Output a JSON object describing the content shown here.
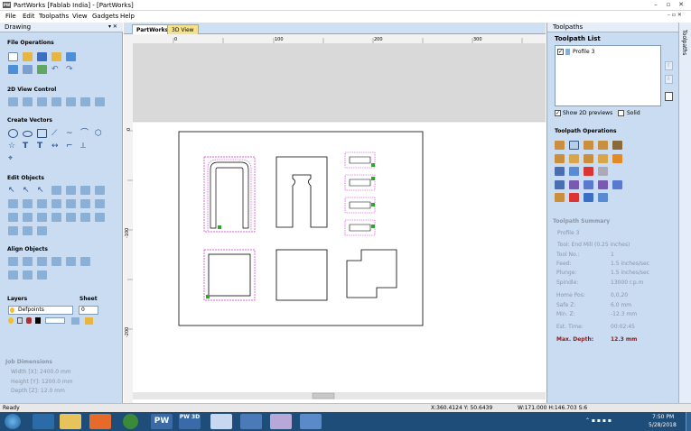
{
  "window": {
    "title": "PartWorks [Fablab India] - [PartWorks]",
    "min": "–",
    "restore": "▫",
    "close": "✕"
  },
  "menu": [
    "File",
    "Edit",
    "Toolpaths",
    "View",
    "Gadgets",
    "Help"
  ],
  "left_panel": {
    "title": "Drawing",
    "pin": "▾ ✕",
    "sections": [
      "File Operations",
      "2D View Control",
      "Create Vectors",
      "Edit Objects",
      "Align Objects"
    ],
    "layers_label": "Layers",
    "sheet_label": "Sheet",
    "layer_value": "Defpoints",
    "sheet_value": "0",
    "job_dimensions": {
      "title": "Job Dimensions",
      "width": "Width  [X]: 2400.0 mm",
      "height": "Height [Y]: 1200.0 mm",
      "depth": "Depth  [Z]: 12.0 mm"
    }
  },
  "doc_tabs": [
    "PartWorks",
    "3D View"
  ],
  "ruler": {
    "top": [
      "0",
      "100",
      "200",
      "300",
      "400",
      "500"
    ],
    "left": [
      "0",
      "-100",
      "-200"
    ]
  },
  "right_panel": {
    "title": "Toolpaths",
    "list_title": "Toolpath List",
    "list_items": [
      {
        "name": "Profile 3",
        "checked": true
      }
    ],
    "show_2d": "Show 2D previews",
    "solid": "Solid",
    "ops_title": "Toolpath Operations",
    "summary_title": "Toolpath Summary",
    "summary_name": "Profile 3",
    "summary_tool": "Tool: End Mill (0.25 inches)",
    "summary": [
      {
        "label": "Tool No.:",
        "value": "1"
      },
      {
        "label": "Feed:",
        "value": "1.5 inches/sec"
      },
      {
        "label": "Plunge:",
        "value": "1.5 inches/sec"
      },
      {
        "label": "Spindle:",
        "value": "13000 r.p.m"
      },
      {
        "label": "Home Pos:",
        "value": "0,0,20"
      },
      {
        "label": "Safe Z:",
        "value": "6.0 mm"
      },
      {
        "label": "Min. Z:",
        "value": "-12.3 mm"
      },
      {
        "label": "Est. Time:",
        "value": "00:02:45"
      }
    ],
    "max_depth_label": "Max. Depth:",
    "max_depth_value": "12.3 mm",
    "side_tab": "Toolpaths"
  },
  "status": {
    "left": "Ready",
    "coords": "X:360.4124 Y: 50.6439",
    "dims": "W:171.000   H:146.703  S:6"
  },
  "taskbar": {
    "time": "7:50 PM",
    "date": "5/28/2018",
    "pw_label": "PW",
    "pw3d_label": "PW 3D"
  },
  "colors": {
    "panel": "#c9dcf2",
    "toolpath": "#d12ed1",
    "max_depth": "#8b1a1a",
    "taskbar": "#1e4d7a"
  }
}
